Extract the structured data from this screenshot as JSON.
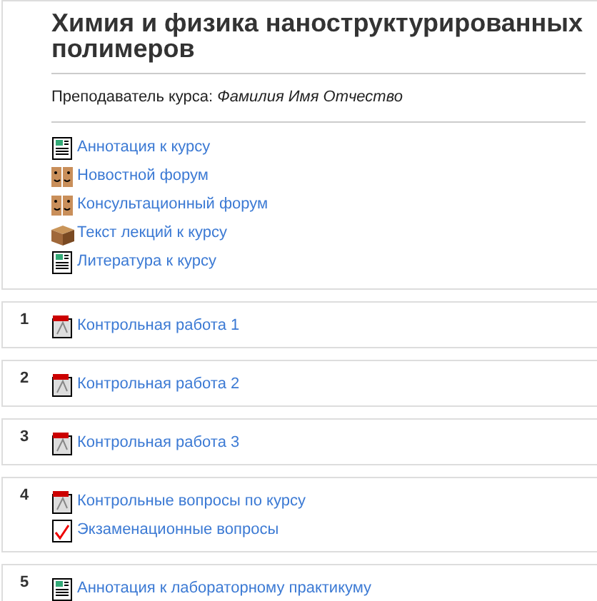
{
  "course": {
    "title": "Химия и физика наноструктурированных полимеров",
    "teacher_label": "Преподаватель курса:",
    "teacher_name": "Фамилия Имя Отчество",
    "items": [
      {
        "kind": "document",
        "label": "Аннотация к курсу"
      },
      {
        "kind": "forum",
        "label": "Новостной форум"
      },
      {
        "kind": "forum",
        "label": "Консультационный форум"
      },
      {
        "kind": "package",
        "label": "Текст лекций к курсу"
      },
      {
        "kind": "document",
        "label": "Литература к курсу"
      }
    ]
  },
  "sections": [
    {
      "number": "1",
      "items": [
        {
          "kind": "pdf",
          "label": "Контрольная работа 1"
        }
      ]
    },
    {
      "number": "2",
      "items": [
        {
          "kind": "pdf",
          "label": "Контрольная работа 2"
        }
      ]
    },
    {
      "number": "3",
      "items": [
        {
          "kind": "pdf",
          "label": "Контрольная работа 3"
        }
      ]
    },
    {
      "number": "4",
      "items": [
        {
          "kind": "pdf",
          "label": "Контрольные вопросы по курсу"
        },
        {
          "kind": "quiz",
          "label": "Экзаменационные вопросы"
        }
      ]
    },
    {
      "number": "5",
      "items": [
        {
          "kind": "document",
          "label": "Аннотация к лабораторному практикуму"
        }
      ]
    }
  ]
}
